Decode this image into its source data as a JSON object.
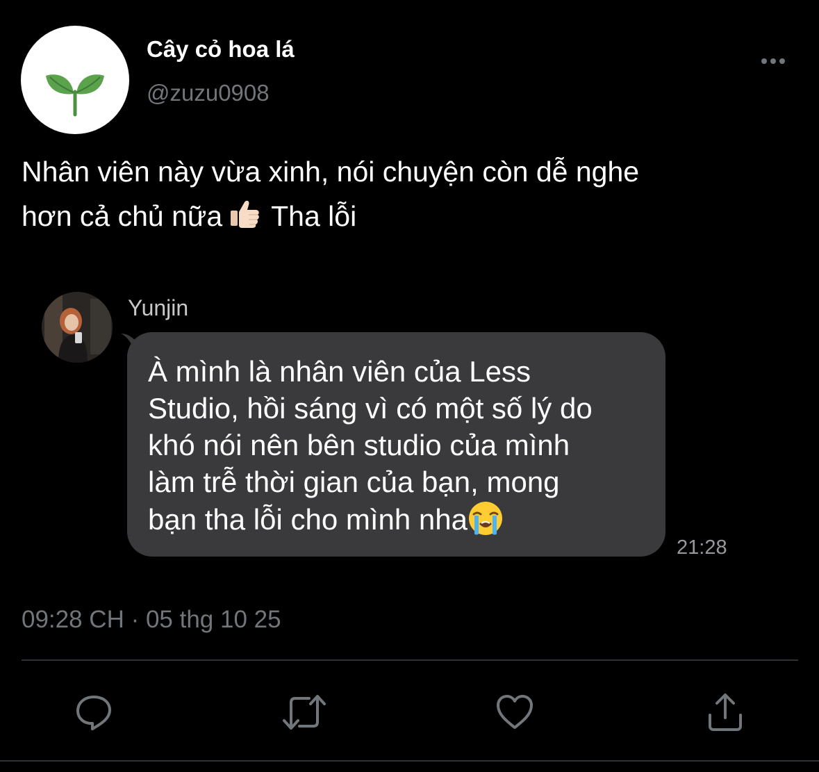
{
  "author": {
    "display_name": "Cây cỏ hoa lá",
    "handle": "@zuzu0908",
    "avatar_icon": "sprout-icon"
  },
  "tweet": {
    "text_line1": "Nhân viên này vừa xinh, nói chuyện còn dễ nghe",
    "text_line2_before": "hơn cả chủ nữa",
    "text_line2_emoji": "thumbs-up-emoji",
    "text_line2_after": "Tha lỗi",
    "timestamp": "09:28 CH · 05 thg 10 25"
  },
  "embedded_chat": {
    "sender": "Yunjin",
    "message_lines": [
      "À mình là nhân viên của Less",
      "Studio, hồi sáng vì có một số lý do",
      "khó nói nên bên studio của mình",
      "làm trễ thời gian của bạn, mong",
      "bạn tha lỗi cho mình nha"
    ],
    "message_emoji": "loudly-crying-emoji",
    "time": "21:28"
  },
  "actions": {
    "icons": [
      "reply-icon",
      "retweet-icon",
      "like-icon",
      "share-icon"
    ]
  },
  "colors": {
    "background": "#000000",
    "secondary_text": "#71767b",
    "bubble": "#3a3a3c",
    "icon": "#71767b",
    "divider": "#2f3336"
  }
}
